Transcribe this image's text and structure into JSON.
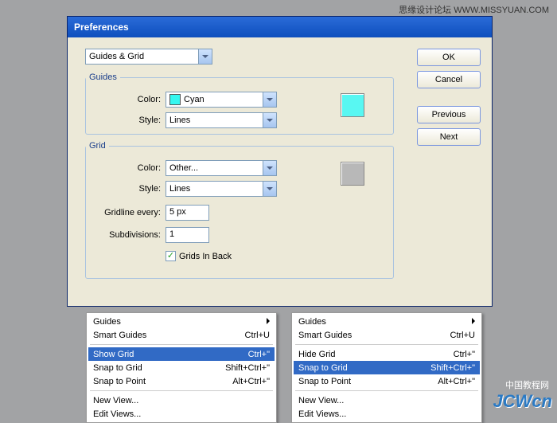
{
  "page": {
    "top_right": "思缘设计论坛 WWW.MISSYUAN.COM",
    "watermark": "JCWcn",
    "watermark_sub": "中国教程网"
  },
  "dialog": {
    "title": "Preferences",
    "category": "Guides & Grid",
    "buttons": {
      "ok": "OK",
      "cancel": "Cancel",
      "previous": "Previous",
      "next": "Next"
    }
  },
  "guides": {
    "legend": "Guides",
    "color_label": "Color:",
    "color_value": "Cyan",
    "style_label": "Style:",
    "style_value": "Lines",
    "swatch_color": "#58f7f2"
  },
  "grid": {
    "legend": "Grid",
    "color_label": "Color:",
    "color_value": "Other...",
    "style_label": "Style:",
    "style_value": "Lines",
    "gridline_label": "Gridline every:",
    "gridline_value": "5 px",
    "subdiv_label": "Subdivisions:",
    "subdiv_value": "1",
    "gridsinback_label": "Grids In Back",
    "gridsinback_checked": true,
    "swatch_color": "#b8b8b8"
  },
  "menu_left": {
    "items": [
      {
        "label": "Guides",
        "shortcut": "",
        "submenu": true
      },
      {
        "label": "Smart Guides",
        "shortcut": "Ctrl+U"
      },
      {
        "sep": true
      },
      {
        "label": "Show Grid",
        "shortcut": "Ctrl+\"",
        "selected": true
      },
      {
        "label": "Snap to Grid",
        "shortcut": "Shift+Ctrl+\""
      },
      {
        "label": "Snap to Point",
        "shortcut": "Alt+Ctrl+\""
      },
      {
        "sep": true
      },
      {
        "label": "New View..."
      },
      {
        "label": "Edit Views..."
      }
    ]
  },
  "menu_right": {
    "items": [
      {
        "label": "Guides",
        "shortcut": "",
        "submenu": true
      },
      {
        "label": "Smart Guides",
        "shortcut": "Ctrl+U"
      },
      {
        "sep": true
      },
      {
        "label": "Hide Grid",
        "shortcut": "Ctrl+\""
      },
      {
        "label": "Snap to Grid",
        "shortcut": "Shift+Ctrl+\"",
        "selected": true
      },
      {
        "label": "Snap to Point",
        "shortcut": "Alt+Ctrl+\""
      },
      {
        "sep": true
      },
      {
        "label": "New View..."
      },
      {
        "label": "Edit Views..."
      }
    ]
  }
}
